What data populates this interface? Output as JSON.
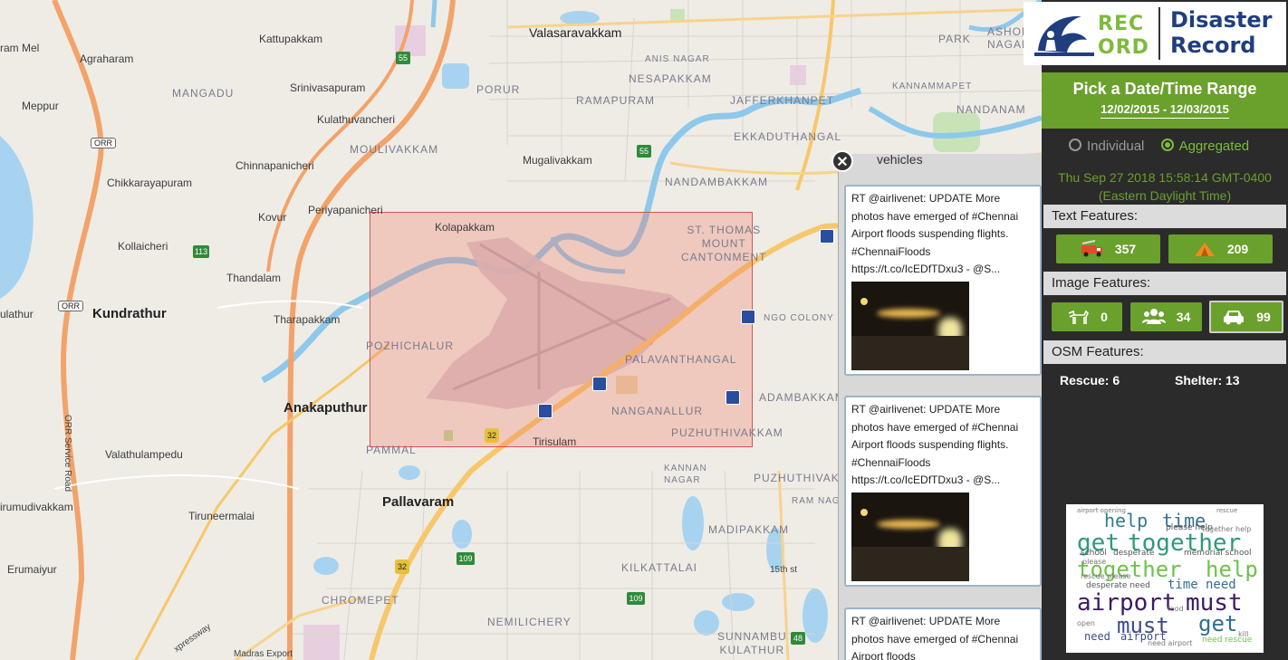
{
  "map": {
    "labels": {
      "valasaravakkam": "Valasaravakkam",
      "kattupakkam": "Kattupakkam",
      "ashok_nagar": "ASHOK\nNAGAR",
      "park": "PARK",
      "ram_mel": "ram Mel",
      "agraharam": "Agraharam",
      "mangadu": "MANGADU",
      "srinivasapuram": "Srinivasapuram",
      "anis_nagar": "ANIS NAGAR",
      "nesapakkam": "NESAPAKKAM",
      "kannammapet": "KANNAMMAPET",
      "meppur": "Meppur",
      "porur": "PORUR",
      "ramapuram": "RAMAPURAM",
      "jafferkhanpet": "JAFFERKHANPET",
      "nandanam": "NANDANAM",
      "kulathuvancheri": "Kulathuvancheri",
      "orr": "ORR",
      "moulivakkam": "MOULIVAKKAM",
      "ekkaduthangal": "EKKADUTHANGAL",
      "chinnapanicheri": "Chinnapanicheri",
      "mugalivakkam": "Mugalivakkam",
      "chikkarayapuram": "Chikkarayapuram",
      "nandambakkam": "NANDAMBAKKAM",
      "kovur": "Kovur",
      "periyapanicheri": "Periyapanicheri",
      "kolapakkam": "Kolapakkam",
      "st_thomas": "ST. THOMAS\nMOUNT\nCANTONMENT",
      "kollaicheri": "Kollaicheri",
      "thandalam": "Thandalam",
      "ulathur": "ulathur",
      "kundrathur": "Kundrathur",
      "tharapakkam": "Tharapakkam",
      "ngo_colony": "NGO COLONY",
      "pozhichalur": "POZHICHALUR",
      "palavanthangal": "PALAVANTHANGAL",
      "adambakkam": "ADAMBAKKAM",
      "anakaputhur": "Anakaputhur",
      "nanganallur": "NANGANALLUR",
      "puzhuthivakkam": "PUZHUTHIVAKKAM",
      "valathulampedu": "Valathulampedu",
      "pammal": "PAMMAL",
      "tirisulam": "Tirisulam",
      "kannan_nagar": "KANNAN\nNAGAR",
      "puzhuthivakkam2": "PUZHUTHIVAKK",
      "orr_service_road": "ORR Service Road",
      "pallavaram": "Pallavaram",
      "ram_nagar": "RAM NAG",
      "irumudivakkam": "irumudivakkam",
      "tiruneermalai": "Tiruneermalai",
      "madipakkam": "MADIPAKKAM",
      "erumaiyur": "Erumaiyur",
      "kilkattalai": "KILKATTALAI",
      "15th_st": "15th st",
      "chromepet": "CHROMEPET",
      "nemilichery": "NEMILICHERY",
      "sunnambu": "SUNNAMBU\nKULATHUR",
      "expressway": "xpressway",
      "madras_export": "Madras Export"
    },
    "shields": [
      "55",
      "55",
      "113",
      "32",
      "32",
      "109",
      "109",
      "48"
    ]
  },
  "popup": {
    "close": "✕",
    "title": "vehicles",
    "tweets": [
      {
        "text": "RT @airlivenet: UPDATE More photos have emerged of #Chennai Airport floods suspending flights. #ChennaiFloods https://t.co/IcEDfTDxu3 - @S..."
      },
      {
        "text": "RT @airlivenet: UPDATE More photos have emerged of #Chennai Airport floods suspending flights. #ChennaiFloods https://t.co/IcEDfTDxu3 - @S..."
      },
      {
        "text": "RT @airlivenet: UPDATE More photos have emerged of #Chennai Airport floods"
      }
    ]
  },
  "sidebar": {
    "logo_rec_1": "REC",
    "logo_rec_2": "ORD",
    "logo_title_1": "Disaster",
    "logo_title_2": "Record",
    "date_title": "Pick a Date/Time Range",
    "date_range": "12/02/2015 - 12/03/2015",
    "mode_individual": "Individual",
    "mode_aggregated": "Aggregated",
    "timestamp_1": "Thu Sep 27 2018 15:58:14 GMT-0400",
    "timestamp_2": "(Eastern Daylight Time)",
    "text_features_label": "Text Features:",
    "text_features": [
      {
        "icon": "fire-truck-icon",
        "count": "357"
      },
      {
        "icon": "tent-icon",
        "count": "209"
      }
    ],
    "image_features_label": "Image Features:",
    "image_features": [
      {
        "icon": "dog-icon",
        "count": "0"
      },
      {
        "icon": "people-icon",
        "count": "34"
      },
      {
        "icon": "car-icon",
        "count": "99"
      }
    ],
    "osm_features_label": "OSM Features:",
    "osm_rescue": "Rescue: 6",
    "osm_shelter": "Shelter: 13",
    "wordcloud": [
      "help",
      "time",
      "get",
      "together",
      "together",
      "help",
      "airport",
      "must",
      "must",
      "get",
      "need",
      "airport",
      "time",
      "need",
      "please help",
      "school",
      "desperate",
      "memorial school",
      "airport opening",
      "desperate need",
      "rescue",
      "need rescue",
      "please",
      "food",
      "kill",
      "open",
      "rescue please",
      "together help",
      "need airport"
    ]
  },
  "colors": {
    "accent_green": "#6aa02c",
    "selection": "#d9534f",
    "logo_blue": "#1f3e80",
    "logo_green": "#7dbb3c"
  }
}
